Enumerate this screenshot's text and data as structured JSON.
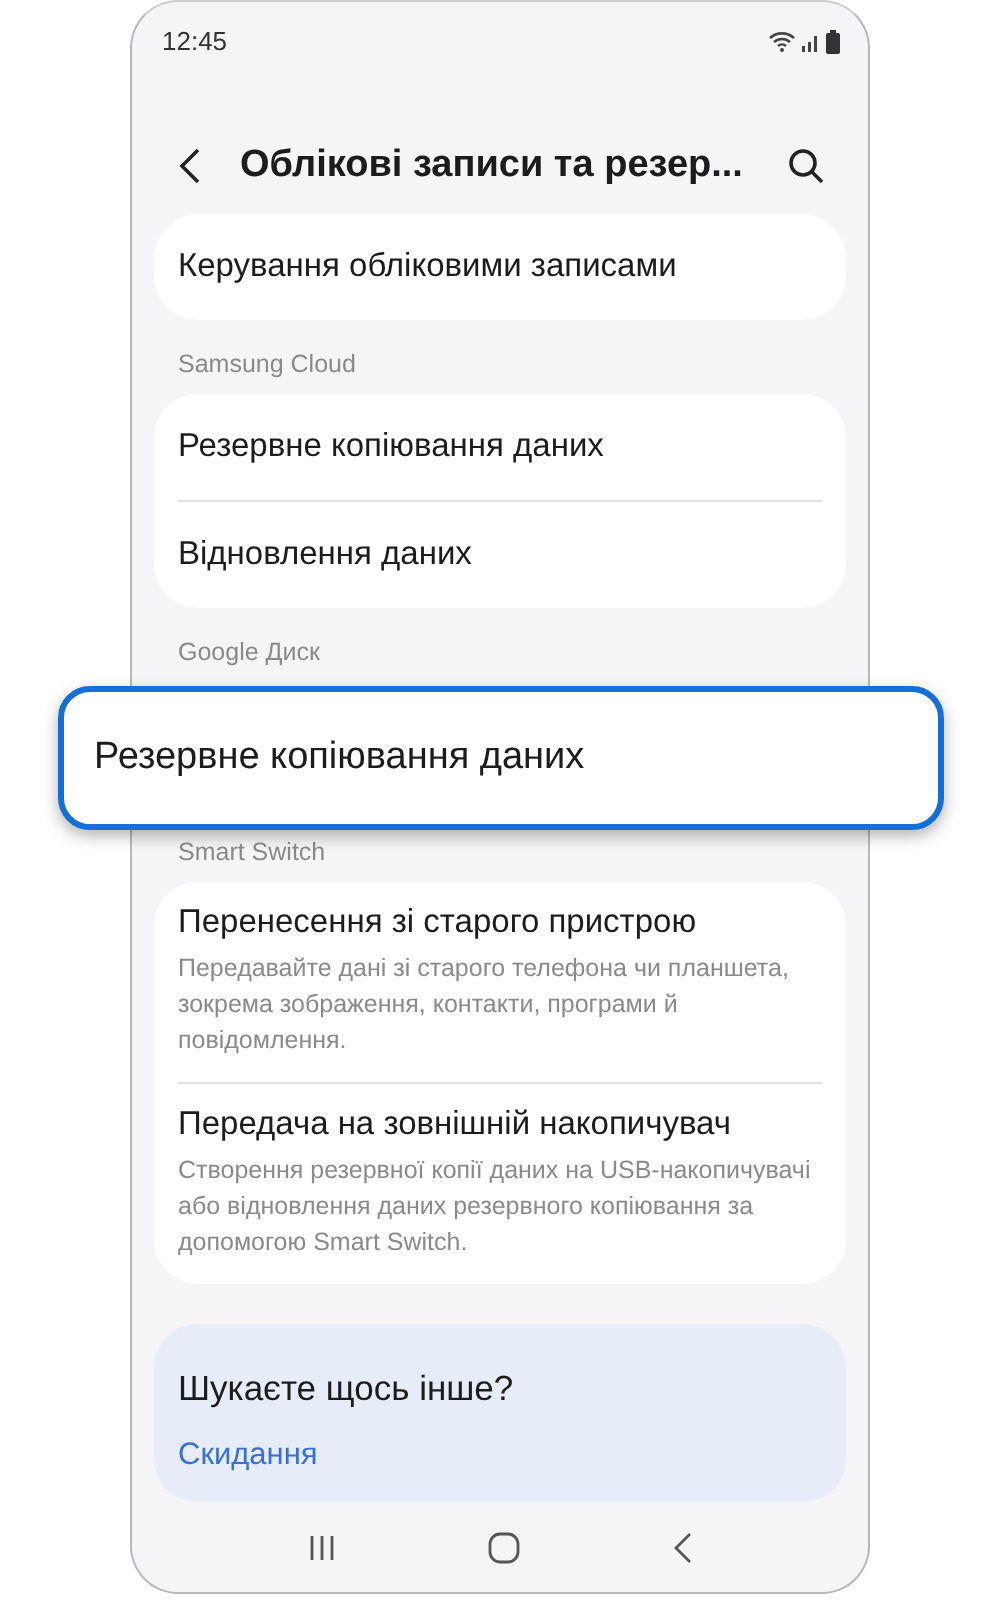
{
  "status_bar": {
    "time": "12:45"
  },
  "header": {
    "title": "Облікові записи та резер..."
  },
  "sections": [
    {
      "items": [
        {
          "title": "Керування обліковими записами"
        }
      ]
    },
    {
      "heading": "Samsung Cloud",
      "items": [
        {
          "title": "Резервне копіювання даних"
        },
        {
          "title": "Відновлення даних"
        }
      ]
    },
    {
      "heading": "Google Диск",
      "highlighted": true,
      "items": [
        {
          "title": "Резервне копіювання даних"
        }
      ]
    },
    {
      "heading": "Smart Switch",
      "items": [
        {
          "title": "Перенесення зі старого пристрою",
          "subtitle": "Передавайте дані зі старого телефона чи планшета, зокрема зображення, контакти, програми й повідомлення."
        },
        {
          "title": "Передача на зовнішній накопичувач",
          "subtitle": "Створення резервної копії даних на USB-накопичувачі або відновлення даних резервного копіювання за допомогою Smart Switch."
        }
      ]
    }
  ],
  "help": {
    "title": "Шукаєте щось інше?",
    "links": [
      "Скидання"
    ]
  }
}
